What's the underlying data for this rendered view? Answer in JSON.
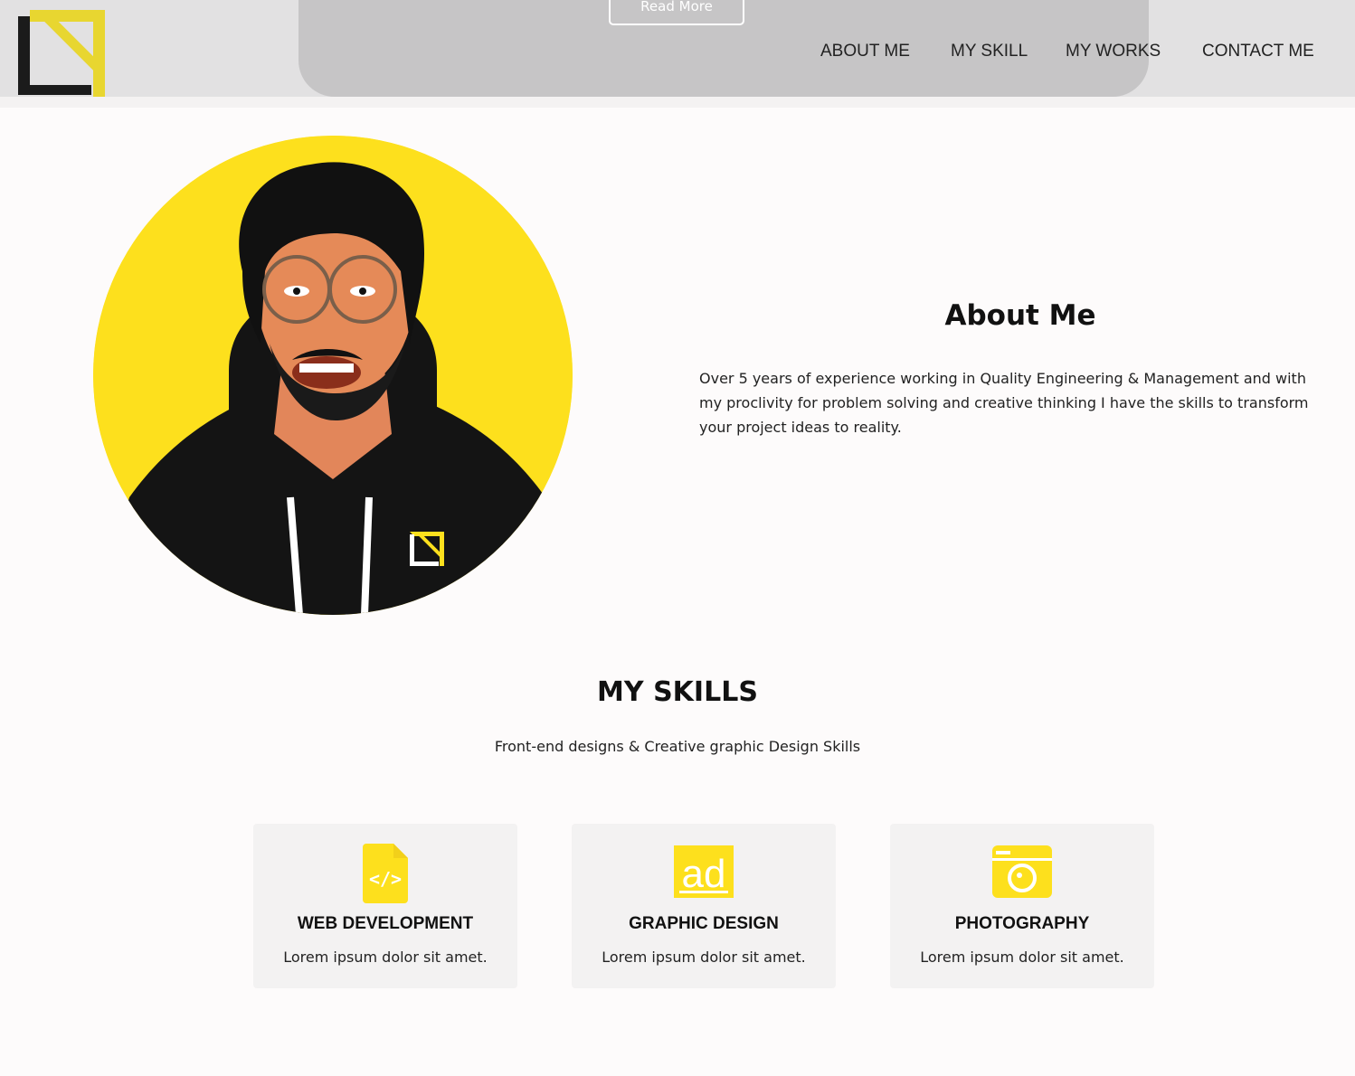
{
  "header": {
    "read_more_label": "Read More",
    "nav": [
      {
        "label": "ABOUT ME"
      },
      {
        "label": "MY SKILL"
      },
      {
        "label": "MY WORKS"
      },
      {
        "label": "CONTACT ME"
      }
    ]
  },
  "colors": {
    "accent": "#fde01d",
    "text": "#111111",
    "card_bg": "#f3f2f2"
  },
  "about": {
    "title": "About Me",
    "text": "Over 5 years of experience working in Quality Engineering & Management and with my proclivity for problem solving and creative thinking I have the skills to transform your project ideas to reality."
  },
  "skills": {
    "title": "MY SKILLS",
    "subtitle": "Front-end designs & Creative graphic Design Skills",
    "cards": [
      {
        "icon": "code-file-icon",
        "title": "WEB DEVELOPMENT",
        "desc": "Lorem ipsum dolor sit amet."
      },
      {
        "icon": "ad-icon",
        "title": "GRAPHIC DESIGN",
        "desc": "Lorem ipsum dolor sit amet."
      },
      {
        "icon": "camera-icon",
        "title": "PHOTOGRAPHY",
        "desc": "Lorem ipsum dolor sit amet."
      }
    ]
  }
}
